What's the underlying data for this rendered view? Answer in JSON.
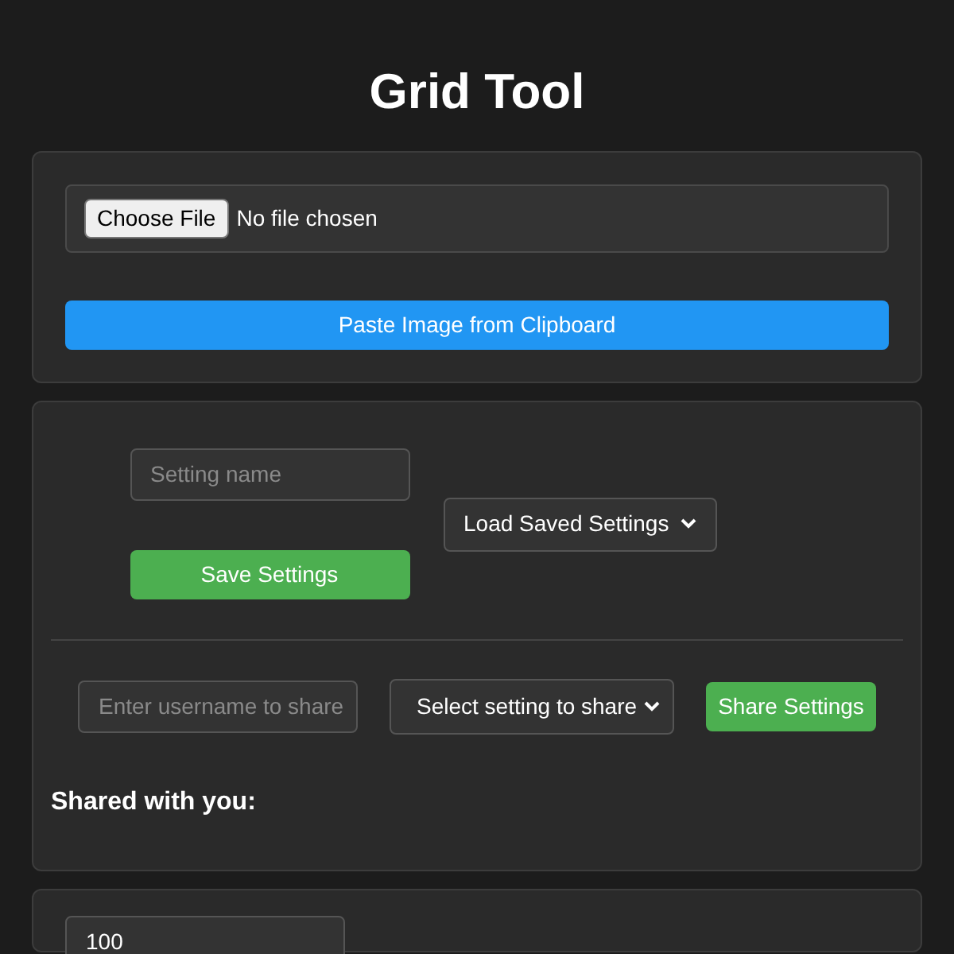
{
  "title": "Grid Tool",
  "upload": {
    "file_button": "Choose File",
    "file_status": "No file chosen",
    "paste_button": "Paste Image from Clipboard"
  },
  "settings": {
    "name_placeholder": "Setting name",
    "save_button": "Save Settings",
    "load_select": "Load Saved Settings"
  },
  "sharing": {
    "username_placeholder": "Enter username to share",
    "setting_select": "Select setting to share",
    "share_button": "Share Settings",
    "shared_heading": "Shared with you:"
  },
  "grid": {
    "size_value": "100"
  }
}
